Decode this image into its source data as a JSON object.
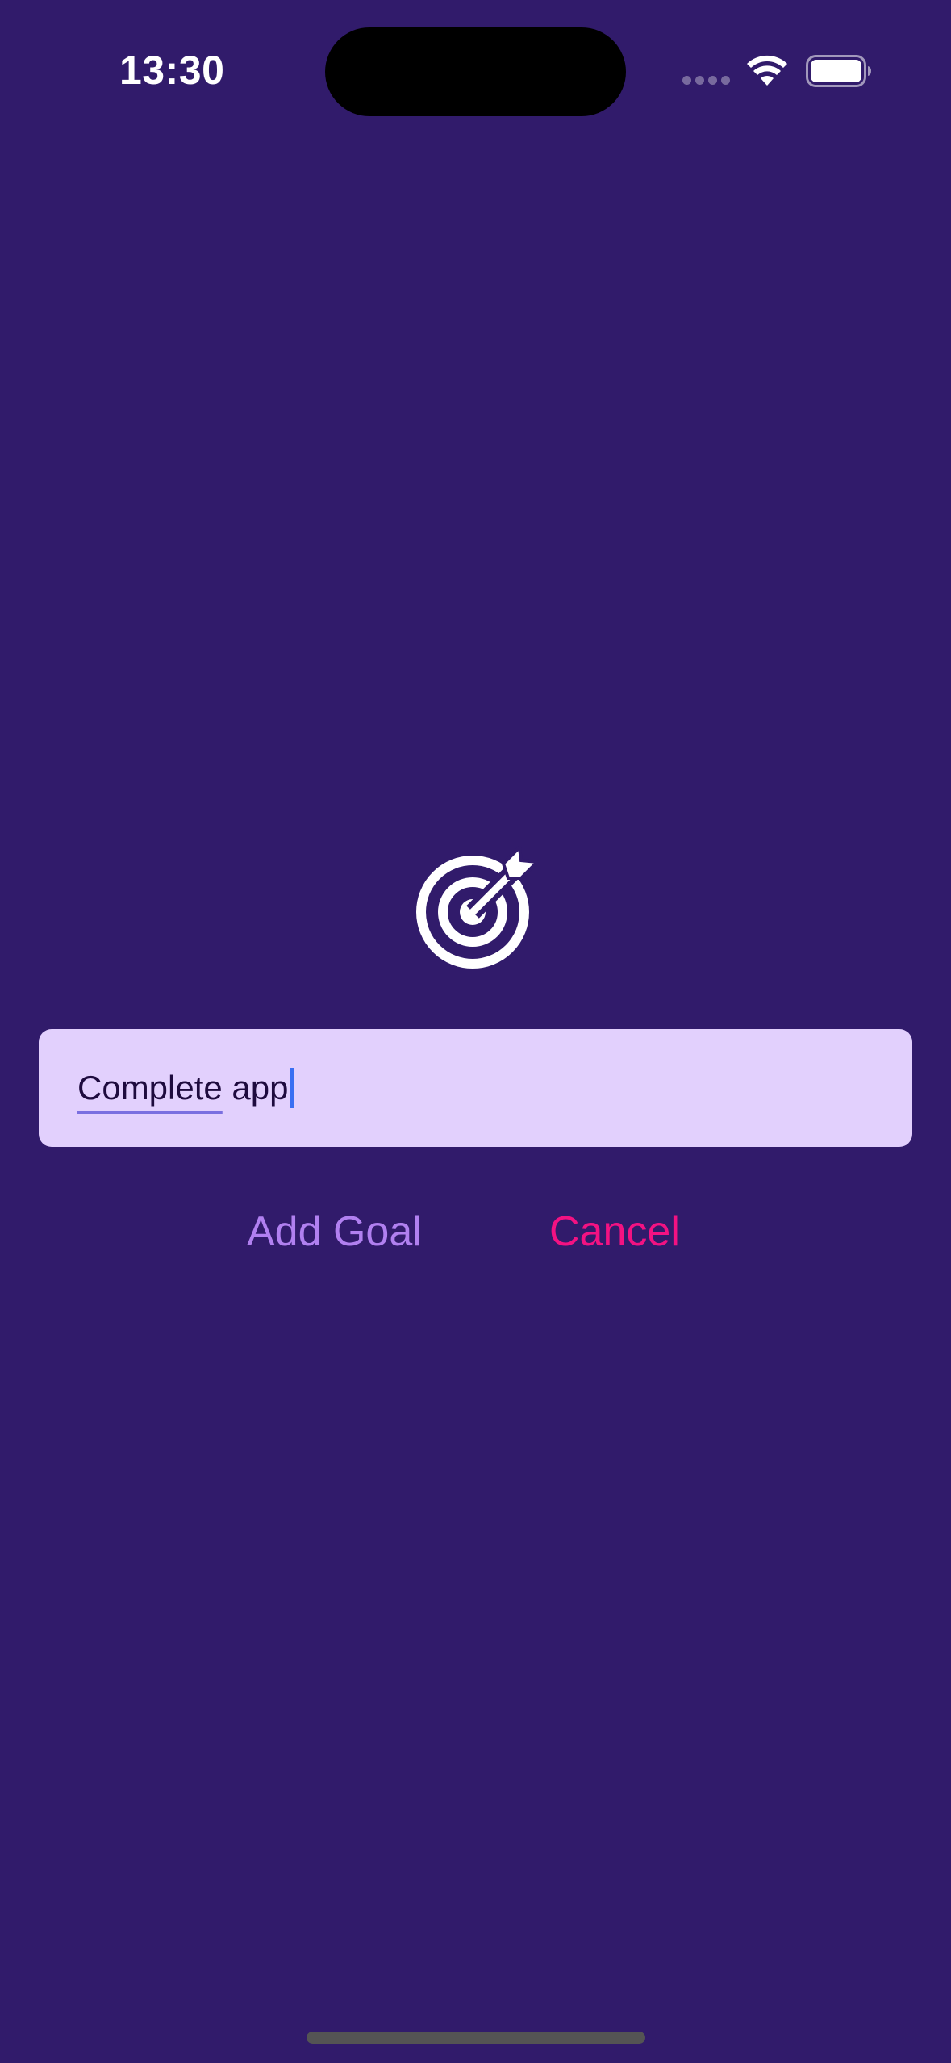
{
  "status_bar": {
    "time": "13:30",
    "icons": [
      "signal-dots-icon",
      "wifi-icon",
      "battery-icon"
    ]
  },
  "hero": {
    "icon": "target-arrow-icon"
  },
  "goal_input": {
    "value_underlined": "Complete",
    "value_rest": " app",
    "placeholder": ""
  },
  "actions": {
    "add_goal_label": "Add Goal",
    "cancel_label": "Cancel"
  },
  "colors": {
    "background": "#311b6b",
    "input_background": "#e2d0fd",
    "add_goal": "#b180f0",
    "cancel": "#f31282",
    "caret": "#3a6ff2"
  }
}
